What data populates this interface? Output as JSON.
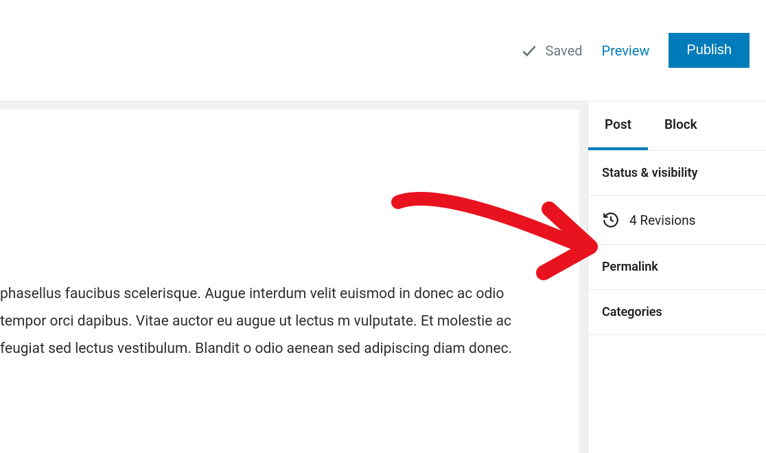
{
  "topbar": {
    "saved_label": "Saved",
    "preview_label": "Preview",
    "publish_label": "Publish"
  },
  "editor": {
    "body_text": " phasellus faucibus scelerisque. Augue interdum velit euismod in  donec ac odio tempor orci dapibus. Vitae auctor eu augue ut lectus m vulputate. Et molestie ac feugiat sed lectus vestibulum. Blandit o odio aenean sed adipiscing diam donec."
  },
  "sidebar": {
    "tabs": {
      "post": "Post",
      "block": "Block"
    },
    "panels": {
      "status": "Status & visibility",
      "revisions": "4 Revisions",
      "permalink": "Permalink",
      "categories": "Categories"
    }
  }
}
